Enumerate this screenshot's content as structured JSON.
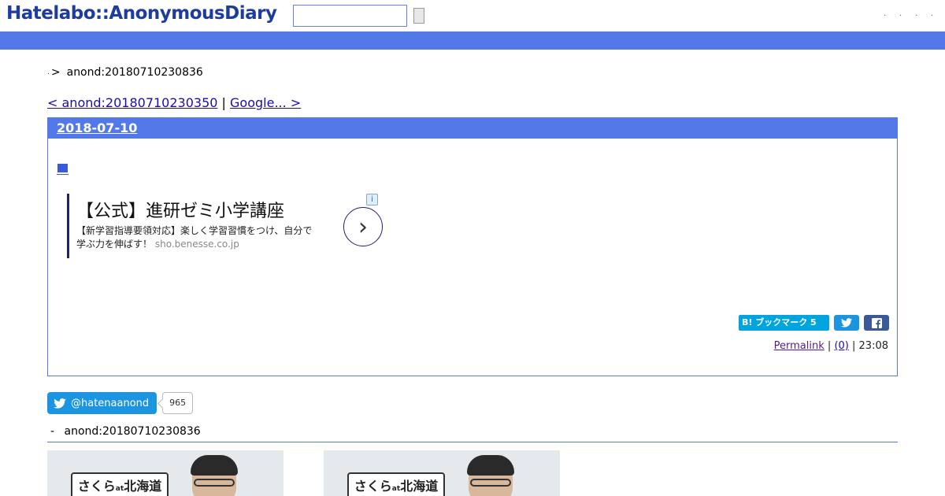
{
  "header": {
    "logo": "Hatelabo::AnonymousDiary",
    "search_value": "",
    "top_links": [
      ".",
      ".",
      ".",
      "."
    ]
  },
  "breadcrumb": {
    "home": ".",
    "separator": ">",
    "current": "anond:20180710230836"
  },
  "pager": {
    "prev": "< anond:20180710230350",
    "divider": "|",
    "next": "Google... > "
  },
  "day": {
    "date": "2018-07-10",
    "section_marker": "■"
  },
  "ad": {
    "title": "【公式】進研ゼミ小学講座",
    "description": "【新学習指導要領対応】楽しく学習習慣をつけ、自分で学ぶ力を伸ばす！",
    "domain": "sho.benesse.co.jp",
    "arrow": "›",
    "info": "i"
  },
  "share": {
    "hatena_label": "B! ブックマーク 5"
  },
  "entry_footer": {
    "permalink": "Permalink",
    "sep1": "|",
    "comments": "(0)",
    "sep2": "|",
    "time": "23:08"
  },
  "twitter_follow": {
    "handle": "@hatenaanond",
    "count": "965"
  },
  "related": {
    "dash": "-",
    "title": "anond:20180710230836"
  },
  "thumbnails": [
    {
      "label_main": "さくら",
      "label_small": "at",
      "label_place": "北海道"
    },
    {
      "label_main": "さくら",
      "label_small": "at",
      "label_place": "北海道"
    }
  ],
  "colors": {
    "brand_blue": "#5279e7",
    "logo_blue": "#1d3c9e",
    "twitter": "#1b95e0",
    "facebook": "#3b5998",
    "hatena": "#00a4de"
  }
}
